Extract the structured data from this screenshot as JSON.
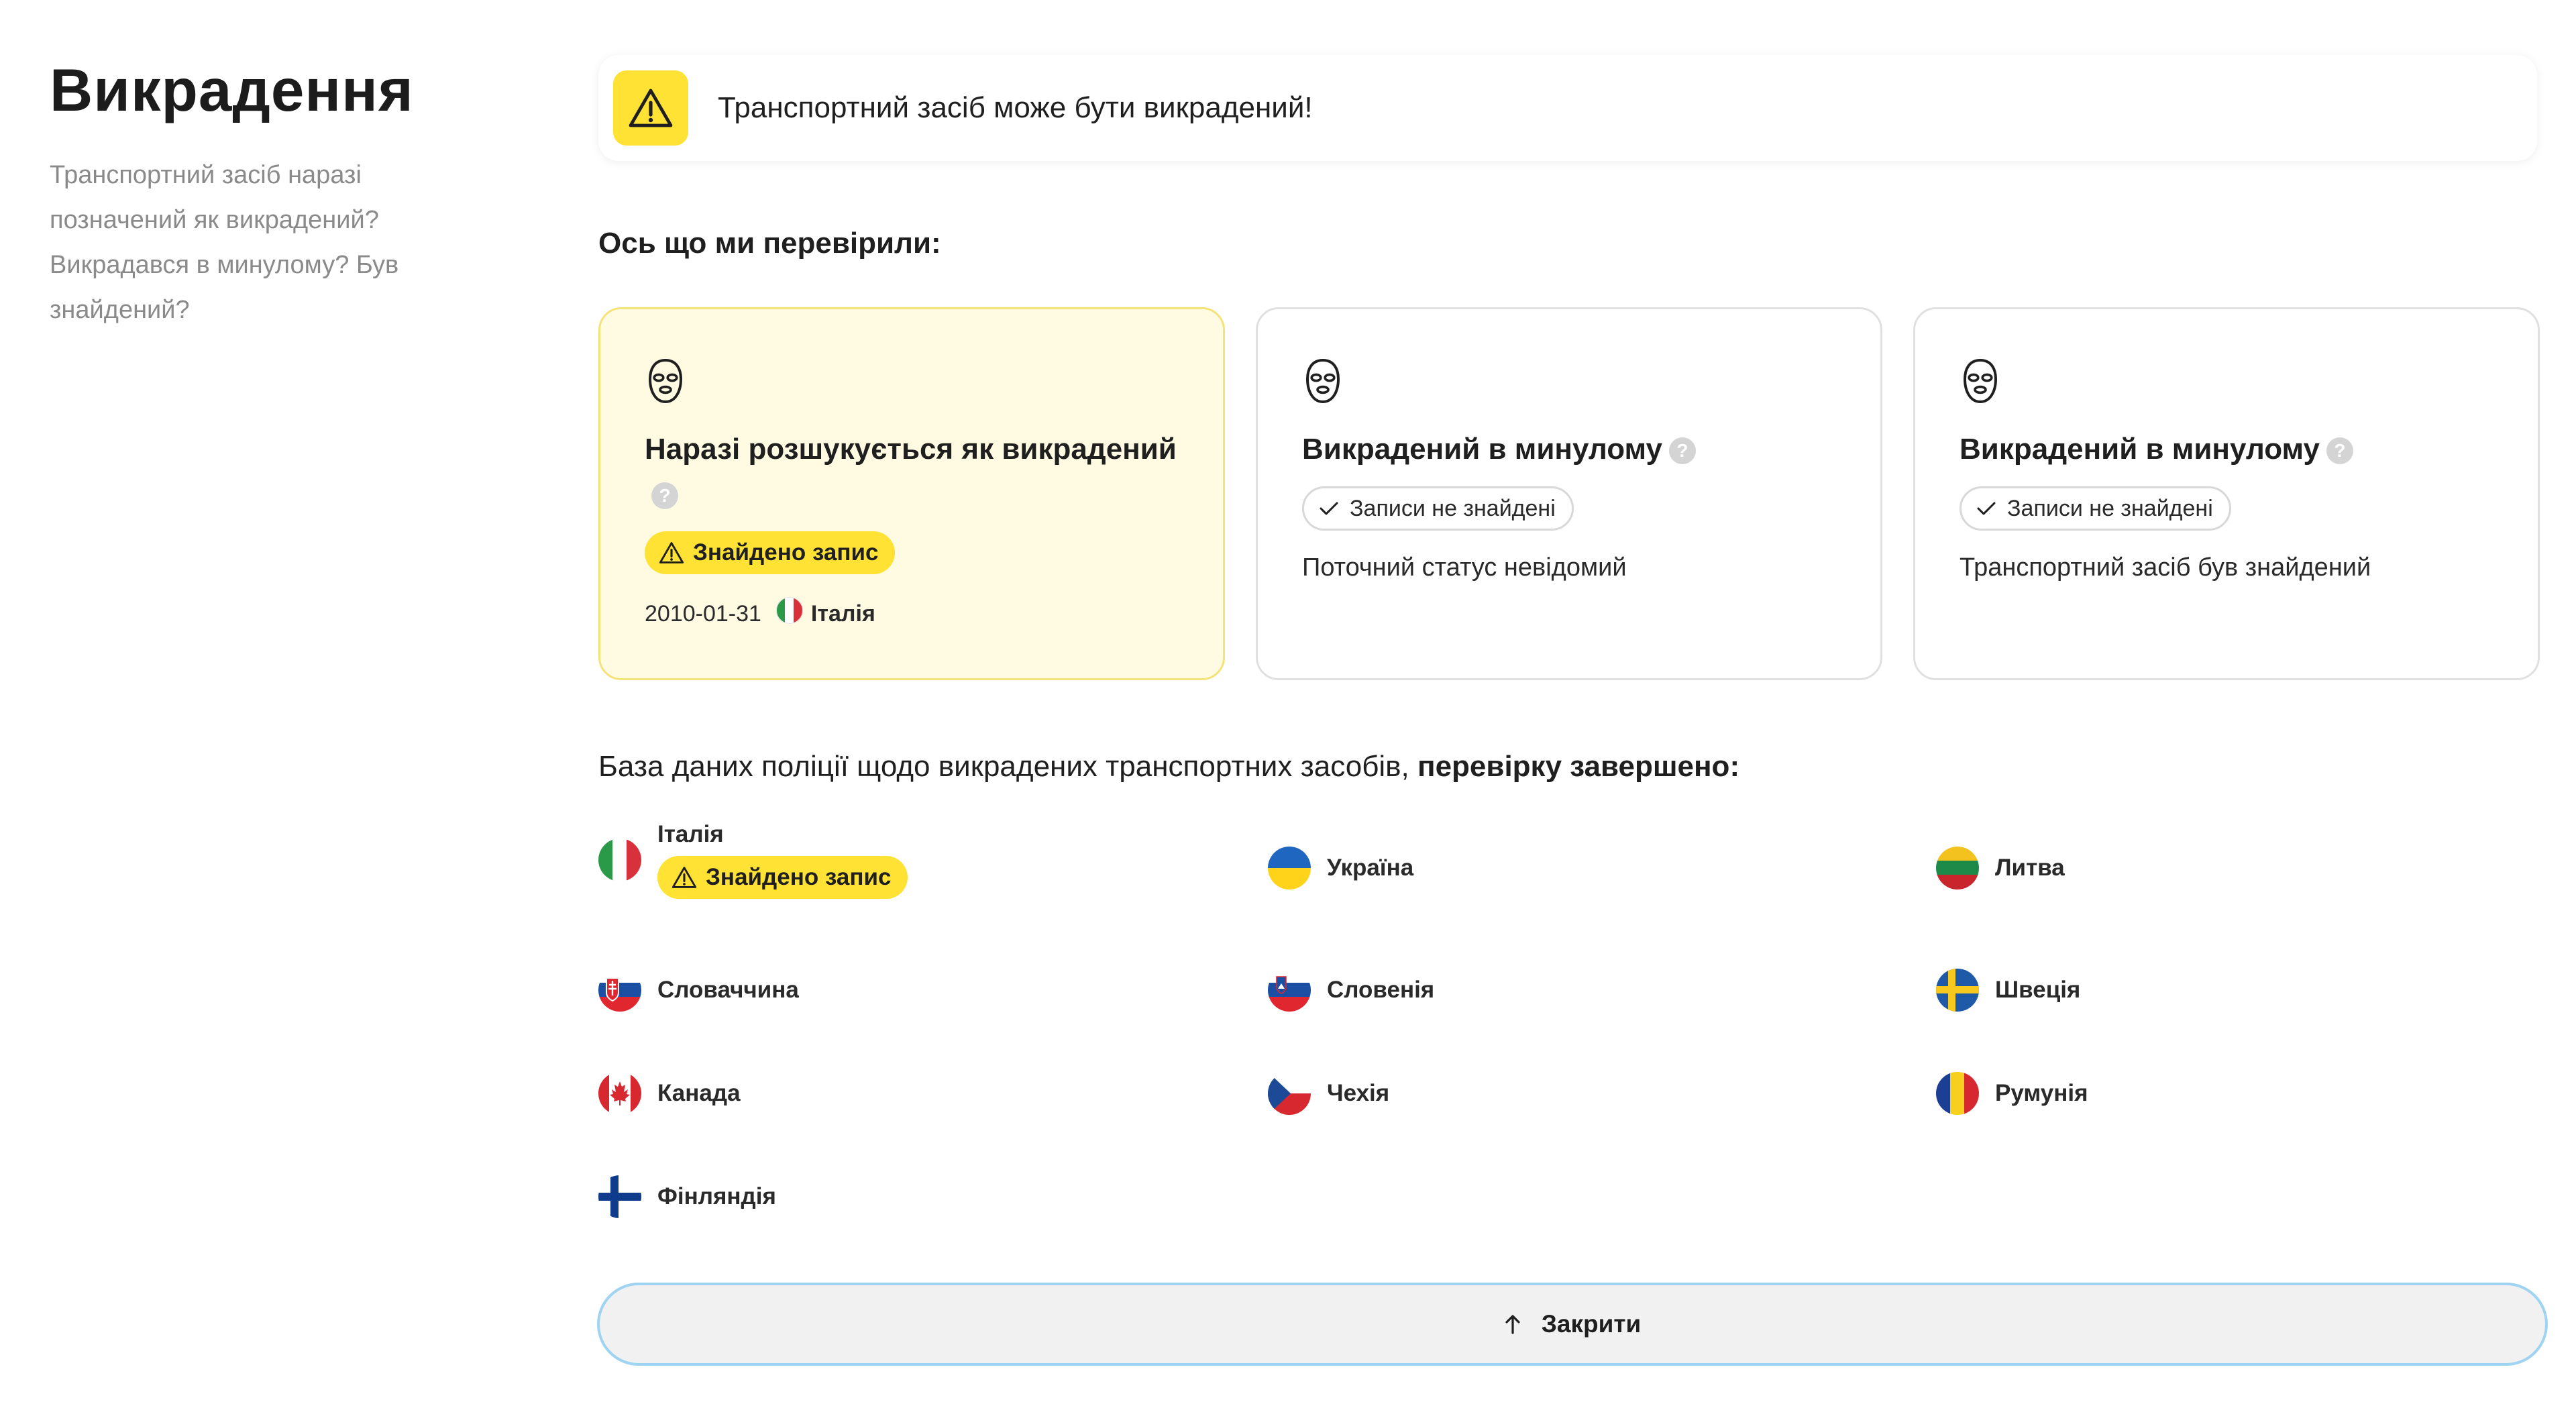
{
  "sidebar": {
    "title": "Викрадення",
    "description": "Транспортний засіб наразі позначений як викрадений? Викрадався в минулому? Був знайдений?"
  },
  "alert": {
    "text": "Транспортний засіб може бути викрадений!",
    "icon": "warning-triangle-icon",
    "color": "#ffe234"
  },
  "checked_heading": "Ось що ми перевірили:",
  "cards": [
    {
      "title": "Наразі розшукується як викрадений",
      "badge": "Знайдено запис",
      "date": "2010-01-31",
      "country": "Італія",
      "icon": "balaclava-icon"
    },
    {
      "title": "Викрадений в минулому",
      "badge": "Записи не знайдені",
      "status": "Поточний статус невідомий",
      "icon": "balaclava-icon"
    },
    {
      "title": "Викрадений в минулому",
      "badge": "Записи не знайдені",
      "status": "Транспортний засіб був знайдений",
      "icon": "balaclava-icon"
    }
  ],
  "db_heading": {
    "prefix": "База даних поліції щодо викрадених транспортних засобів, ",
    "bold": "перевірку завершено:"
  },
  "countries": [
    {
      "name": "Італія",
      "badge": "Знайдено запис"
    },
    {
      "name": "Україна"
    },
    {
      "name": "Литва"
    },
    {
      "name": "Словаччина"
    },
    {
      "name": "Словенія"
    },
    {
      "name": "Швеція"
    },
    {
      "name": "Канада"
    },
    {
      "name": "Чехія"
    },
    {
      "name": "Румунія"
    },
    {
      "name": "Фінляндія"
    }
  ],
  "close_button": {
    "label": "Закрити",
    "icon": "arrow-up-icon"
  }
}
